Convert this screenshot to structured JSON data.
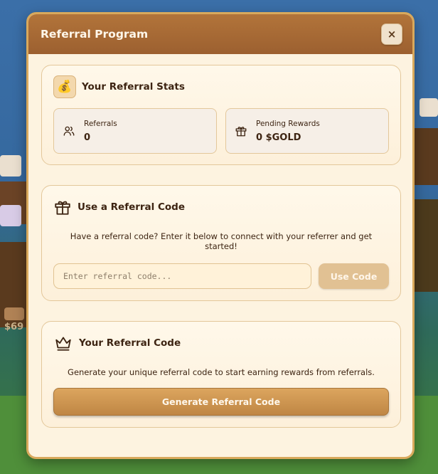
{
  "modal": {
    "title": "Referral Program",
    "close_label": "×"
  },
  "stats_card": {
    "title": "Your Referral Stats",
    "referrals": {
      "label": "Referrals",
      "value": "0"
    },
    "pending": {
      "label": "Pending Rewards",
      "value": "0 $GOLD"
    }
  },
  "use_code_card": {
    "title": "Use a Referral Code",
    "description": "Have a referral code? Enter it below to connect with your referrer and get started!",
    "input_placeholder": "Enter referral code...",
    "input_value": "",
    "button_label": "Use Code"
  },
  "your_code_card": {
    "title": "Your Referral Code",
    "description": "Generate your unique referral code to start earning rewards from referrals.",
    "button_label": "Generate Referral Code"
  },
  "background": {
    "price_text": "$69"
  },
  "colors": {
    "header": "#a86a34",
    "accent": "#d9a95c",
    "text": "#3d2412"
  }
}
